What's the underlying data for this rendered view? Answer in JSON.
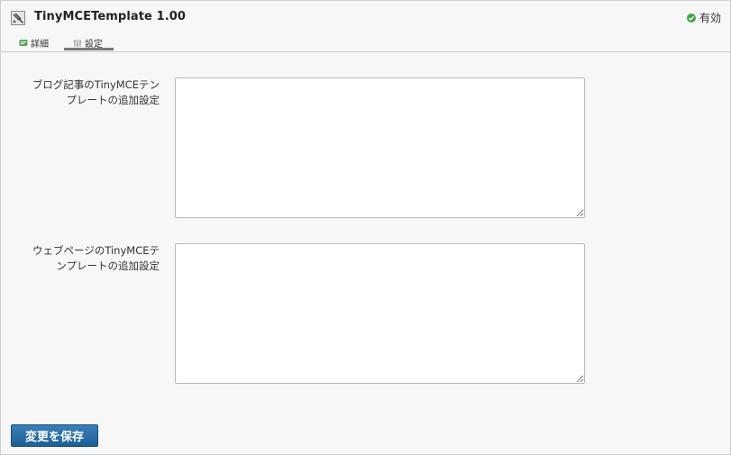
{
  "plugin": {
    "title": "TinyMCETemplate 1.00",
    "icon": "plugin-icon"
  },
  "status": {
    "label": "有効",
    "icon": "check-circle-icon",
    "color": "#46a546"
  },
  "tabs": [
    {
      "label": "詳細",
      "icon": "info-icon",
      "active": false
    },
    {
      "label": "設定",
      "icon": "settings-icon",
      "active": true
    }
  ],
  "fields": [
    {
      "label_line1": "ブログ記事のTinyMCEテン",
      "label_line2": "プレートの追加設定",
      "value": ""
    },
    {
      "label_line1": "ウェブページのTinyMCEテ",
      "label_line2": "ンプレートの追加設定",
      "value": ""
    }
  ],
  "save_button": {
    "label": "変更を保存",
    "color": "#1f6399"
  }
}
